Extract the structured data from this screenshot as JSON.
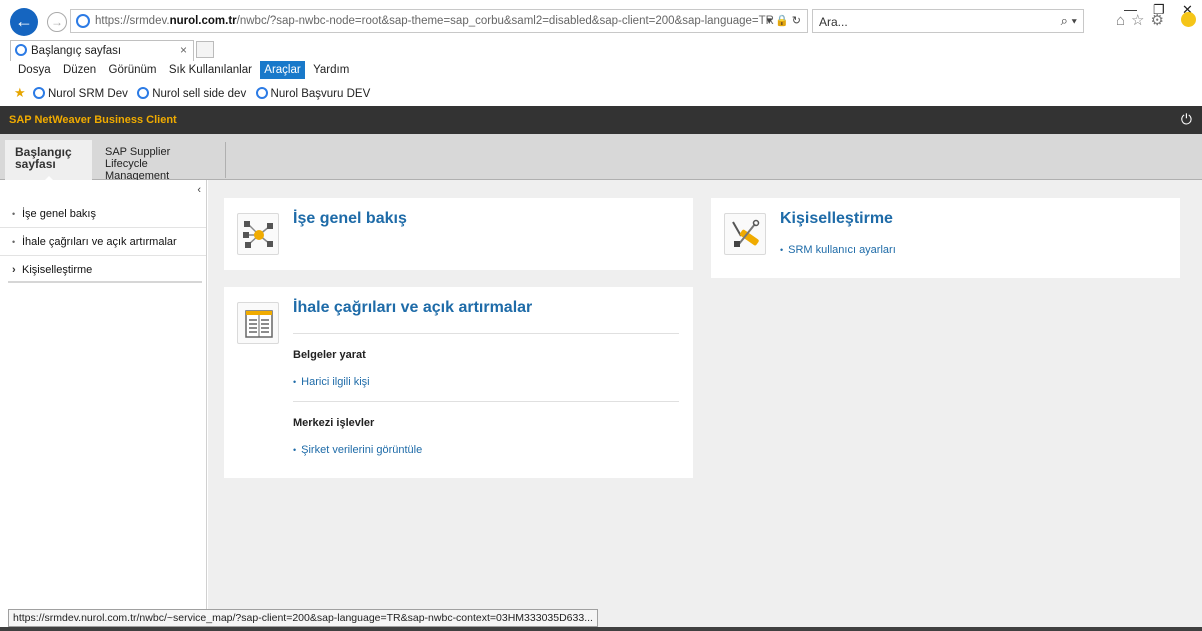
{
  "browser": {
    "url_prefix": "https://srmdev.",
    "url_domain": "nurol.com.tr",
    "url_rest": "/nwbc/?sap-nwbc-node=root&sap-theme=sap_corbu&saml2=disabled&sap-client=200&sap-language=TR",
    "address_icons": "▾ 🔒 ↻",
    "search_placeholder": "Ara...",
    "search_icon": "⌕ ▾",
    "tab_title": "Başlangıç sayfası",
    "tab_close": "×",
    "minimize": "—",
    "restore": "❐",
    "close": "✕",
    "toolbar_icons": "⌂☆⚙",
    "menu": [
      "Dosya",
      "Düzen",
      "Görünüm",
      "Sık Kullanılanlar",
      "Araçlar",
      "Yardım"
    ],
    "favorites": [
      "Nurol SRM Dev",
      "Nurol sell side dev",
      "Nurol Başvuru DEV"
    ],
    "status_url": "https://srmdev.nurol.com.tr/nwbc/~service_map/?sap-client=200&sap-language=TR&sap-nwbc-context=03HM333035D633..."
  },
  "sap": {
    "header_title": "SAP NetWeaver Business Client",
    "tabs": [
      {
        "line1": "Başlangıç",
        "line2": "sayfası"
      },
      {
        "line1": "SAP Supplier",
        "line2": "Lifecycle Management"
      }
    ],
    "nav": [
      {
        "label": "İşe genel bakış"
      },
      {
        "label": "İhale çağrıları ve açık artırmalar"
      },
      {
        "label": "Kişiselleştirme"
      }
    ],
    "cards": {
      "overview": {
        "title": "İşe genel bakış"
      },
      "personalization": {
        "title": "Kişiselleştirme",
        "link": "SRM kullanıcı ayarları"
      },
      "tenders": {
        "title": "İhale çağrıları ve açık artırmalar",
        "section1": "Belgeler yarat",
        "link1": "Harici ilgili kişi",
        "section2": "Merkezi işlevler",
        "link2": "Şirket verilerini görüntüle"
      }
    }
  }
}
